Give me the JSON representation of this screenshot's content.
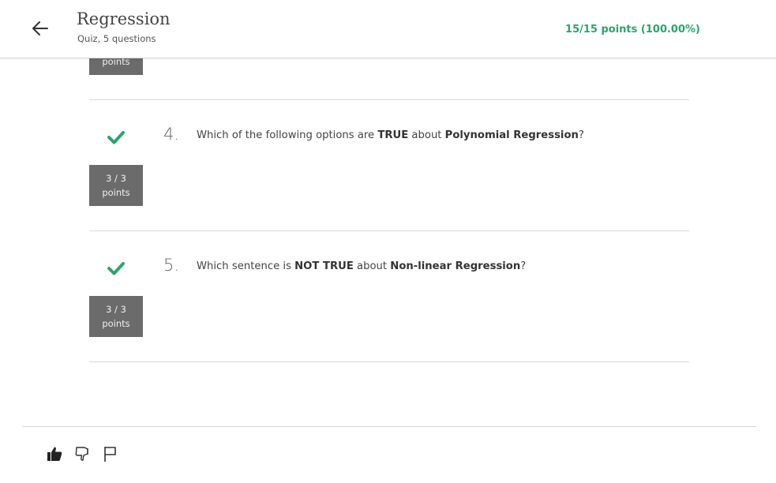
{
  "header": {
    "title": "Regression",
    "subtitle": "Quiz, 5 questions",
    "score": "15/15 points (100.00%)",
    "back_icon": "arrow-left-icon"
  },
  "partial_badge_label": "points",
  "questions": [
    {
      "number": "4.",
      "text_parts": [
        "Which of the following options are ",
        "TRUE",
        " about ",
        "Polynomial Regression",
        "?"
      ],
      "score": "3 / 3",
      "score_label": "points",
      "status_icon": "check-icon"
    },
    {
      "number": "5.",
      "text_parts": [
        "Which sentence is ",
        "NOT TRUE",
        " about ",
        "Non-linear Regression",
        "?"
      ],
      "score": "3 / 3",
      "score_label": "points",
      "status_icon": "check-icon"
    }
  ],
  "footer": {
    "icons": [
      "thumbs-up-icon",
      "thumbs-down-icon",
      "flag-icon"
    ]
  },
  "colors": {
    "accent_green": "#2ba56b",
    "badge_gray": "#6b6b6b"
  }
}
